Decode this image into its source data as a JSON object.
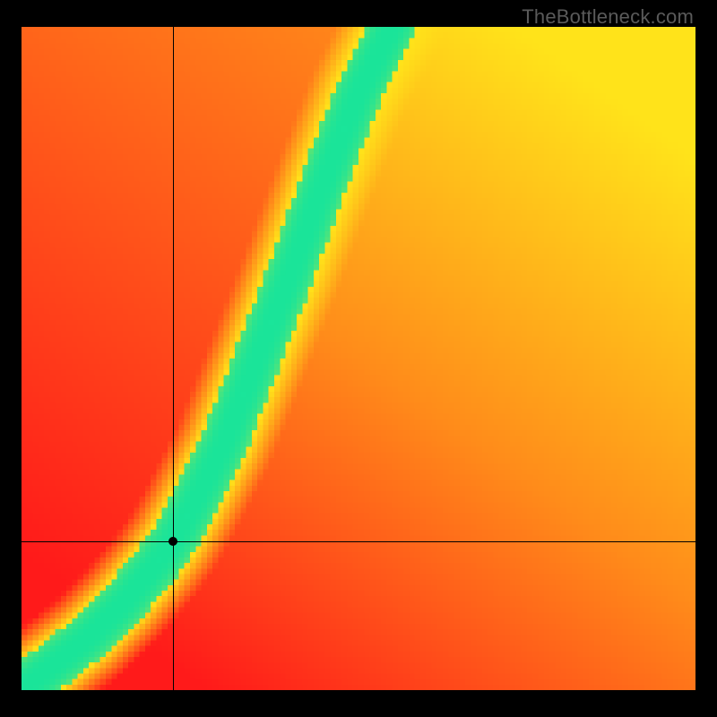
{
  "watermark": "TheBottleneck.com",
  "crosshair": {
    "x_frac": 0.225,
    "y_frac": 0.775
  },
  "marker": {
    "x_frac": 0.225,
    "y_frac": 0.775
  },
  "colors": {
    "red": "#ff1a1a",
    "orange": "#ff8c1a",
    "yellow": "#ffe31a",
    "green": "#1ae59a",
    "black": "#000000"
  },
  "chart_data": {
    "type": "heatmap",
    "title": "",
    "xlabel": "",
    "ylabel": "",
    "x_range": [
      0,
      1
    ],
    "y_range": [
      0,
      1
    ],
    "grid": false,
    "legend": false,
    "description": "Qualitative bottleneck heatmap: a bright green optimal ridge curves from the lower-left corner up toward the top edge near x≈0.55, surrounded by a yellow halo, fading to orange then red away from the ridge. Lower-right half is predominantly red; upper-right corner warms to orange/yellow.",
    "optimal_ridge_points": [
      {
        "x": 0.0,
        "y": 0.0
      },
      {
        "x": 0.05,
        "y": 0.04
      },
      {
        "x": 0.1,
        "y": 0.08
      },
      {
        "x": 0.15,
        "y": 0.13
      },
      {
        "x": 0.2,
        "y": 0.19
      },
      {
        "x": 0.225,
        "y": 0.225
      },
      {
        "x": 0.25,
        "y": 0.27
      },
      {
        "x": 0.3,
        "y": 0.37
      },
      {
        "x": 0.35,
        "y": 0.5
      },
      {
        "x": 0.4,
        "y": 0.63
      },
      {
        "x": 0.45,
        "y": 0.77
      },
      {
        "x": 0.5,
        "y": 0.9
      },
      {
        "x": 0.55,
        "y": 1.0
      }
    ],
    "ridge_half_width_frac": 0.035,
    "halo_half_width_frac": 0.075,
    "crosshair_lines": {
      "x": 0.225,
      "y": 0.225
    },
    "marker_point": {
      "x": 0.225,
      "y": 0.225
    }
  }
}
